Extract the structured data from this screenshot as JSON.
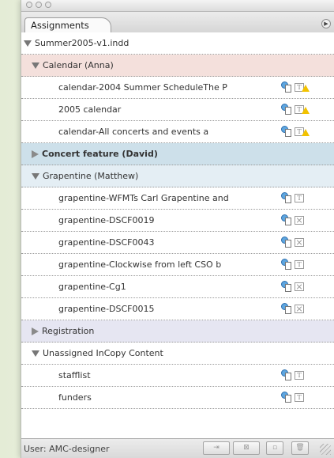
{
  "window": {
    "title": ""
  },
  "tab": {
    "label": "Assignments"
  },
  "rows": [
    {
      "level": 0,
      "label": "Summer2005-v1.indd",
      "expanded": true,
      "bg": "#ffffff",
      "bold": false
    },
    {
      "level": 1,
      "label": "Calendar (Anna)",
      "expanded": true,
      "bg": "#f4e0dc",
      "bold": false
    },
    {
      "level": 2,
      "label": "calendar-2004 Summer ScheduleThe P",
      "icon": "text-warning",
      "bg": "#ffffff"
    },
    {
      "level": 2,
      "label": "2005 calendar",
      "icon": "text-warning",
      "bg": "#ffffff"
    },
    {
      "level": 2,
      "label": "calendar-All concerts and events a",
      "icon": "text-warning",
      "bg": "#ffffff"
    },
    {
      "level": 1,
      "label": "Concert feature (David)",
      "expanded": false,
      "bg": "#cde0ea",
      "bold": true
    },
    {
      "level": 1,
      "label": "Grapentine (Matthew)",
      "expanded": true,
      "bg": "#e4eef4",
      "bold": false
    },
    {
      "level": 2,
      "label": "grapentine-WFMTs Carl Grapentine and",
      "icon": "text",
      "bg": "#ffffff"
    },
    {
      "level": 2,
      "label": "grapentine-DSCF0019",
      "icon": "graphic",
      "bg": "#ffffff"
    },
    {
      "level": 2,
      "label": "grapentine-DSCF0043",
      "icon": "graphic",
      "bg": "#ffffff"
    },
    {
      "level": 2,
      "label": "grapentine-Clockwise from left CSO b",
      "icon": "text",
      "bg": "#ffffff"
    },
    {
      "level": 2,
      "label": "grapentine-Cg1",
      "icon": "graphic",
      "bg": "#ffffff"
    },
    {
      "level": 2,
      "label": "grapentine-DSCF0015",
      "icon": "graphic",
      "bg": "#ffffff"
    },
    {
      "level": 1,
      "label": "Registration",
      "expanded": false,
      "bg": "#e6e6f2",
      "bold": false
    },
    {
      "level": 1,
      "label": "Unassigned InCopy Content",
      "expanded": true,
      "bg": "#ffffff",
      "bold": false
    },
    {
      "level": 2,
      "label": "stafflist",
      "icon": "text",
      "bg": "#ffffff"
    },
    {
      "level": 2,
      "label": "funders",
      "icon": "text",
      "bg": "#ffffff"
    }
  ],
  "status": {
    "user": "User: AMC-designer"
  },
  "icons": [
    "user-content-icon",
    "text-frame-icon",
    "warning-icon",
    "graphic-frame-icon",
    "panel-menu-icon",
    "update-content-icon",
    "assign-icon",
    "new-assignment-icon",
    "trash-icon",
    "resize-grip-icon"
  ]
}
